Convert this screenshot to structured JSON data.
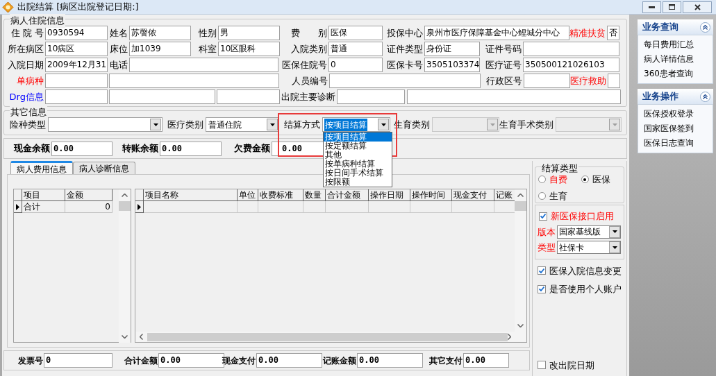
{
  "window": {
    "title": "出院结算 [病区出院登记日期:]"
  },
  "patient_info": {
    "title": "病人住院信息",
    "fields": [
      {
        "label": "住 院 号",
        "value": "0930594"
      },
      {
        "label": "姓名",
        "value": "苏謦侬"
      },
      {
        "label": "性别",
        "value": "男"
      },
      {
        "label": "费　　别",
        "value": "医保"
      },
      {
        "label": "投保中心",
        "value": "泉州市医疗保障基金中心鲤城分中心"
      },
      {
        "label": "精准扶贫",
        "kind": "alert",
        "value": "否"
      },
      {
        "label": "所在病区",
        "value": "10病区"
      },
      {
        "label": "床位",
        "value": "加1039"
      },
      {
        "label": "科室",
        "value": "10区眼科"
      },
      {
        "label": "入院类别",
        "value": "普通"
      },
      {
        "label": "证件类型",
        "value": "身份证"
      },
      {
        "label": "证件号码"
      },
      {
        "label": "入院日期",
        "value": "2009年12月31"
      },
      {
        "label": "电话"
      },
      {
        "label": "医保住院号",
        "value": "0"
      },
      {
        "label": "医保卡号",
        "value": "3505103374"
      },
      {
        "label": "医疗证号",
        "value": "350500121026103"
      },
      {
        "label": "单病种",
        "kind": "alert"
      },
      {
        "label": "人员编号"
      },
      {
        "label": "行政区号"
      },
      {
        "label": "医疗救助",
        "kind": "alert"
      },
      {
        "label": "Drg信息",
        "kind": "link"
      },
      {
        "label": "出院主要诊断"
      }
    ]
  },
  "other_info": {
    "title": "其它信息",
    "fields": [
      {
        "label": "险种类型",
        "disabled": false
      },
      {
        "label": "医疗类别",
        "value": "普通住院",
        "disabled": false
      },
      {
        "label": "结算方式",
        "value": "按项目结算",
        "disabled": false,
        "options": [
          {
            "label": "按项目结算",
            "selected": true
          },
          {
            "label": "按定额结算",
            "selected": false
          },
          {
            "label": "其他",
            "selected": false
          },
          {
            "label": "按单病种结算",
            "selected": false
          },
          {
            "label": "按日间手术结算",
            "selected": false
          },
          {
            "label": "按限额",
            "selected": false
          }
        ]
      },
      {
        "label": "生育类别",
        "disabled": true
      },
      {
        "label": "生育手术类别",
        "disabled": true
      }
    ]
  },
  "balances": [
    {
      "label": "现金余额",
      "value": "0.00"
    },
    {
      "label": "转账余额",
      "value": "0.00"
    },
    {
      "label": "欠费金额",
      "value": "0.00"
    }
  ],
  "tabs": [
    {
      "label": "病人费用信息",
      "selected": true
    },
    {
      "label": "病人诊断信息",
      "selected": false
    }
  ],
  "summary_grid": {
    "columns": [
      "项目",
      "金额"
    ],
    "rows": [
      [
        "合计",
        "0"
      ]
    ]
  },
  "detail_grid": {
    "columns": [
      "项目名称",
      "单位",
      "收费标准",
      "数量",
      "合计金额",
      "操作日期",
      "操作时间",
      "现金支付",
      "记账"
    ]
  },
  "settlement_type": {
    "title": "结算类型",
    "options": [
      {
        "label": "自费",
        "selected": false,
        "kind": "alert"
      },
      {
        "label": "医保",
        "selected": true,
        "kind": "normal"
      },
      {
        "label": "生育",
        "selected": false,
        "kind": "normal"
      }
    ]
  },
  "new_interface": {
    "label": "新医保接口启用",
    "checked": true,
    "fields": [
      {
        "label": "版本",
        "value": "国家基线版"
      },
      {
        "label": "类型",
        "value": "社保卡"
      }
    ]
  },
  "options": [
    {
      "label": "医保入院信息变更",
      "checked": true
    },
    {
      "label": "是否使用个人账户",
      "checked": true
    }
  ],
  "change_discharge_date": {
    "label": "改出院日期",
    "checked": false
  },
  "totals": [
    {
      "label": "发票号",
      "value": "0"
    },
    {
      "label": "合计金额",
      "value": "0.00"
    },
    {
      "label": "现金支付",
      "value": "0.00"
    },
    {
      "label": "记账金额",
      "value": "0.00"
    },
    {
      "label": "其它支付",
      "value": "0.00"
    }
  ],
  "side_panels": [
    {
      "title": "业务查询",
      "expanded": true,
      "items": [
        "每日费用汇总",
        "病人详情信息",
        "360患者查询"
      ]
    },
    {
      "title": "业务操作",
      "expanded": true,
      "items": [
        "医保授权登录",
        "国家医保签到",
        "医保日志查询"
      ]
    }
  ]
}
